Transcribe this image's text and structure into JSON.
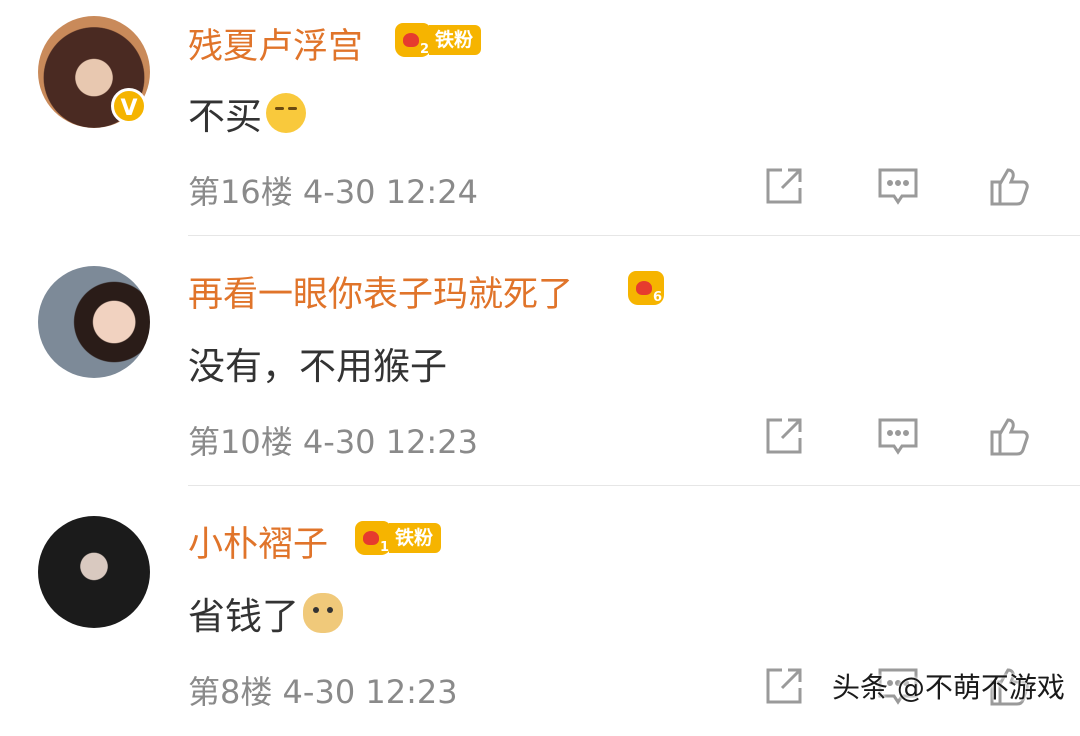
{
  "comments": [
    {
      "username": "残夏卢浮宫",
      "badge_level": "2",
      "badge_label": "铁粉",
      "verified": "V",
      "text": "不买",
      "emoji": "kiss-emoji",
      "floor": "第16楼",
      "time": "4-30 12:24"
    },
    {
      "username": "再看一眼你表子玛就死了",
      "badge_level": "6",
      "text": "没有，不用猴子",
      "floor": "第10楼",
      "time": "4-30 12:23"
    },
    {
      "username": "小朴褶子",
      "badge_level": "1",
      "badge_label": "铁粉",
      "text": "省钱了",
      "emoji": "doge-emoji",
      "floor": "第8楼",
      "time": "4-30 12:23"
    }
  ],
  "icons": {
    "share": "share-icon",
    "reply": "comment-icon",
    "like": "thumbs-up-icon"
  },
  "colors": {
    "username": "#e0742a",
    "badge": "#f6b400",
    "meta_text": "#8a8a8a",
    "icon": "#9a9a9a"
  },
  "watermark": "头条 @不萌不游戏"
}
